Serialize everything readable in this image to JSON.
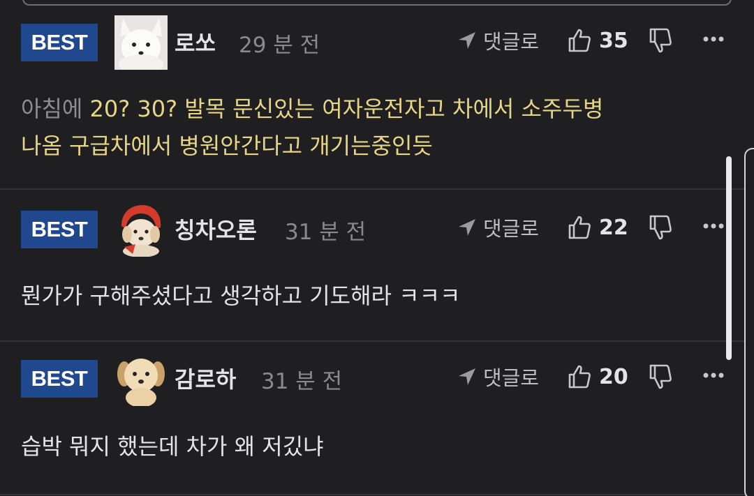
{
  "comments": [
    {
      "badge": "BEST",
      "username": "로쏘",
      "time": "29 분 전",
      "reply_label": "댓글로",
      "likes": "35",
      "text_lead": "아침에 ",
      "text_line1": "20? 30? 발목 문신있는 여자운전자고 차에서 소주두병",
      "text_line2": "나옴 구급차에서 병원안간다고 개기는중인듯",
      "avatar_icon": "white-fox-avatar"
    },
    {
      "badge": "BEST",
      "username": "칭차오론",
      "time": "31 분 전",
      "reply_label": "댓글로",
      "likes": "22",
      "text": "뭔가가 구해주셨다고 생각하고 기도해라 ㅋㅋㅋ",
      "avatar_icon": "puppy-red-hood-avatar"
    },
    {
      "badge": "BEST",
      "username": "감로하",
      "time": "31 분 전",
      "reply_label": "댓글로",
      "likes": "20",
      "text": "습박 뭐지 했는데 차가 왜 저깄냐",
      "avatar_icon": "puppy-avatar"
    }
  ],
  "colors": {
    "background": "#1f1f21",
    "badge": "#20488e",
    "highlight_text": "#e8d687",
    "muted_text": "#8a8a8e",
    "primary_text": "#e4e4e6"
  },
  "icons": {
    "reply": "reply-arrow-icon",
    "like": "thumbs-up-icon",
    "dislike": "thumbs-down-icon",
    "more": "more-dots-icon"
  }
}
